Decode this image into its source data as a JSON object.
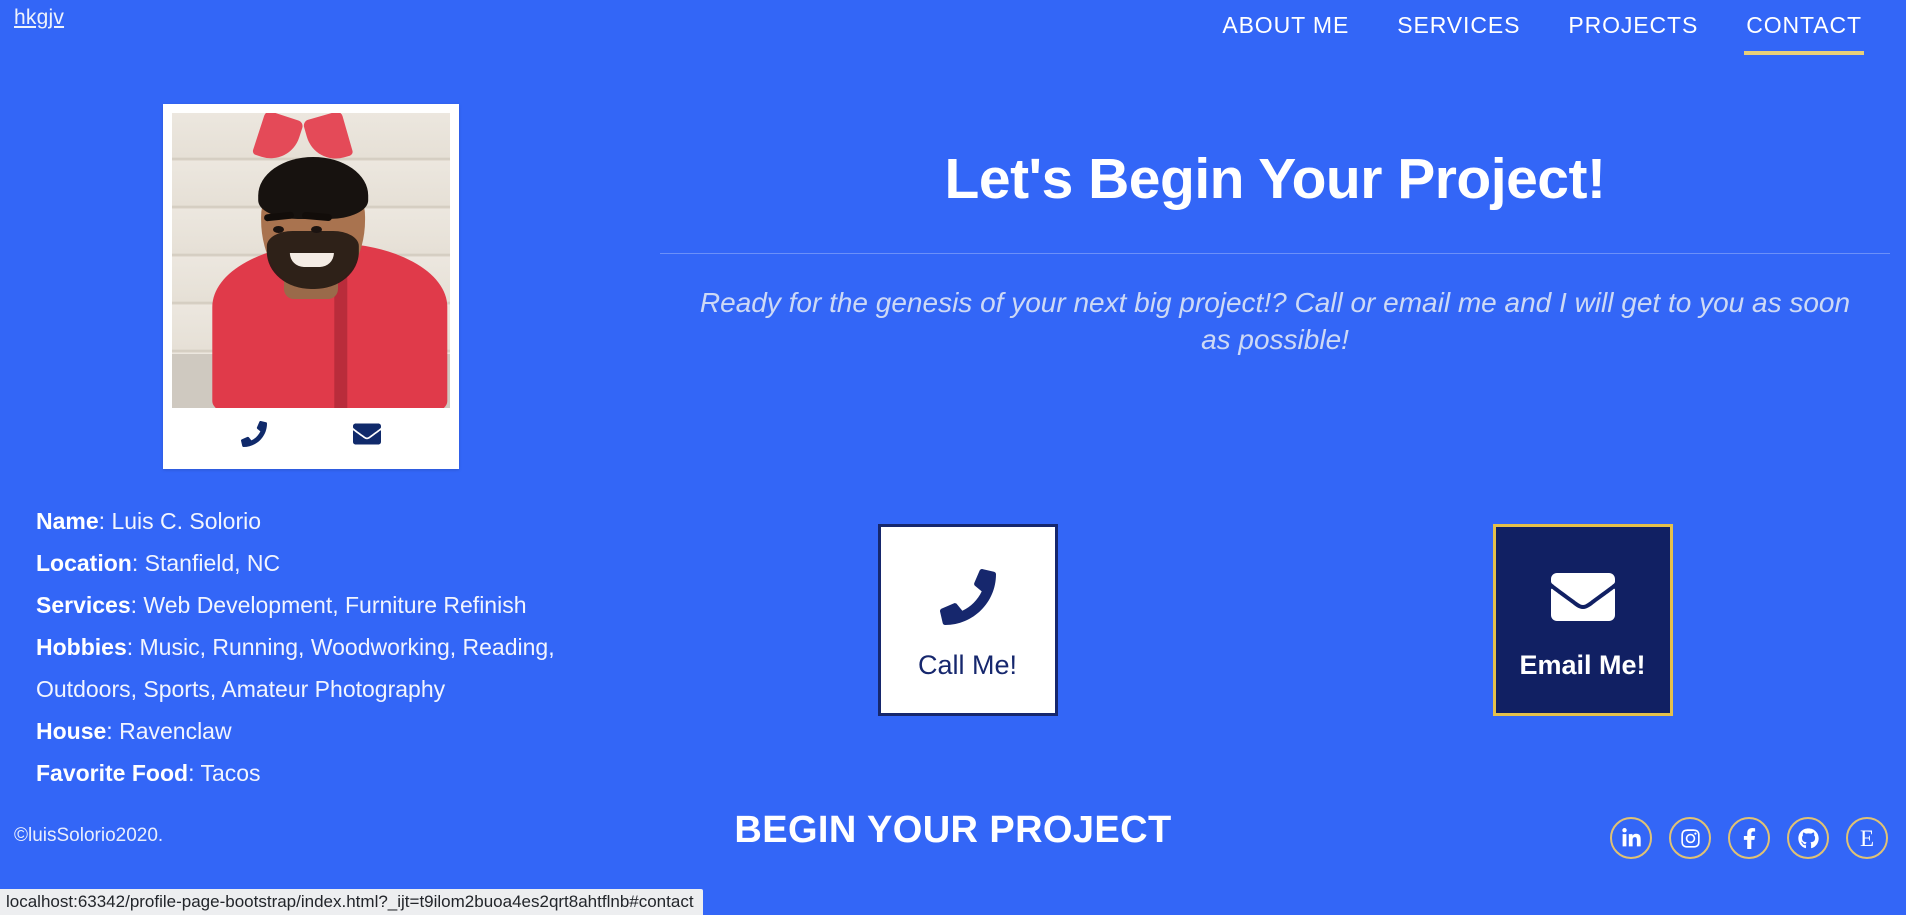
{
  "navbar": {
    "brand": "hkgjv",
    "links": [
      {
        "label": "ABOUT ME",
        "active": false
      },
      {
        "label": "SERVICES",
        "active": false
      },
      {
        "label": "PROJECTS",
        "active": false
      },
      {
        "label": "CONTACT",
        "active": true
      }
    ],
    "active_underline_color": "#e8cf7a"
  },
  "profile_card": {
    "photo_alt": "profile-portrait",
    "actions": [
      {
        "icon": "phone-icon",
        "label": "Call"
      },
      {
        "icon": "envelope-icon",
        "label": "Email"
      }
    ]
  },
  "info": [
    {
      "label": "Name",
      "value": "Luis C. Solorio"
    },
    {
      "label": "Location",
      "value": "Stanfield, NC"
    },
    {
      "label": "Services",
      "value": "Web Development, Furniture Refinish"
    },
    {
      "label": "Hobbies",
      "value": "Music, Running, Woodworking, Reading, Outdoors, Sports, Amateur Photography"
    },
    {
      "label": "House",
      "value": "Ravenclaw"
    },
    {
      "label": "Favorite Food",
      "value": "Tacos"
    }
  ],
  "main": {
    "title": "Let's Begin Your Project!",
    "lead": "Ready for the genesis of your next big project!? Call or email me and I will get to you as soon as possible!"
  },
  "cta": {
    "call": {
      "label": "Call Me!",
      "icon": "phone-icon"
    },
    "email": {
      "label": "Email Me!",
      "icon": "envelope-icon"
    }
  },
  "footer": {
    "copyright": "©luisSolorio2020.",
    "title": "BEGIN YOUR PROJECT",
    "socials": [
      {
        "name": "linkedin-icon",
        "label": "in"
      },
      {
        "name": "instagram-icon",
        "label": "Instagram"
      },
      {
        "name": "facebook-icon",
        "label": "f"
      },
      {
        "name": "github-icon",
        "label": "GitHub"
      },
      {
        "name": "etsy-icon",
        "label": "E"
      }
    ]
  },
  "status_bar": {
    "url": "localhost:63342/profile-page-bootstrap/index.html?_ijt=t9ilom2buoa4es2qrt8ahtflnb#contact"
  },
  "colors": {
    "page_background": "#3366f7",
    "navy": "#112063",
    "gold": "#e5c04a",
    "white": "#ffffff",
    "lead_text": "#cdd9f5"
  }
}
